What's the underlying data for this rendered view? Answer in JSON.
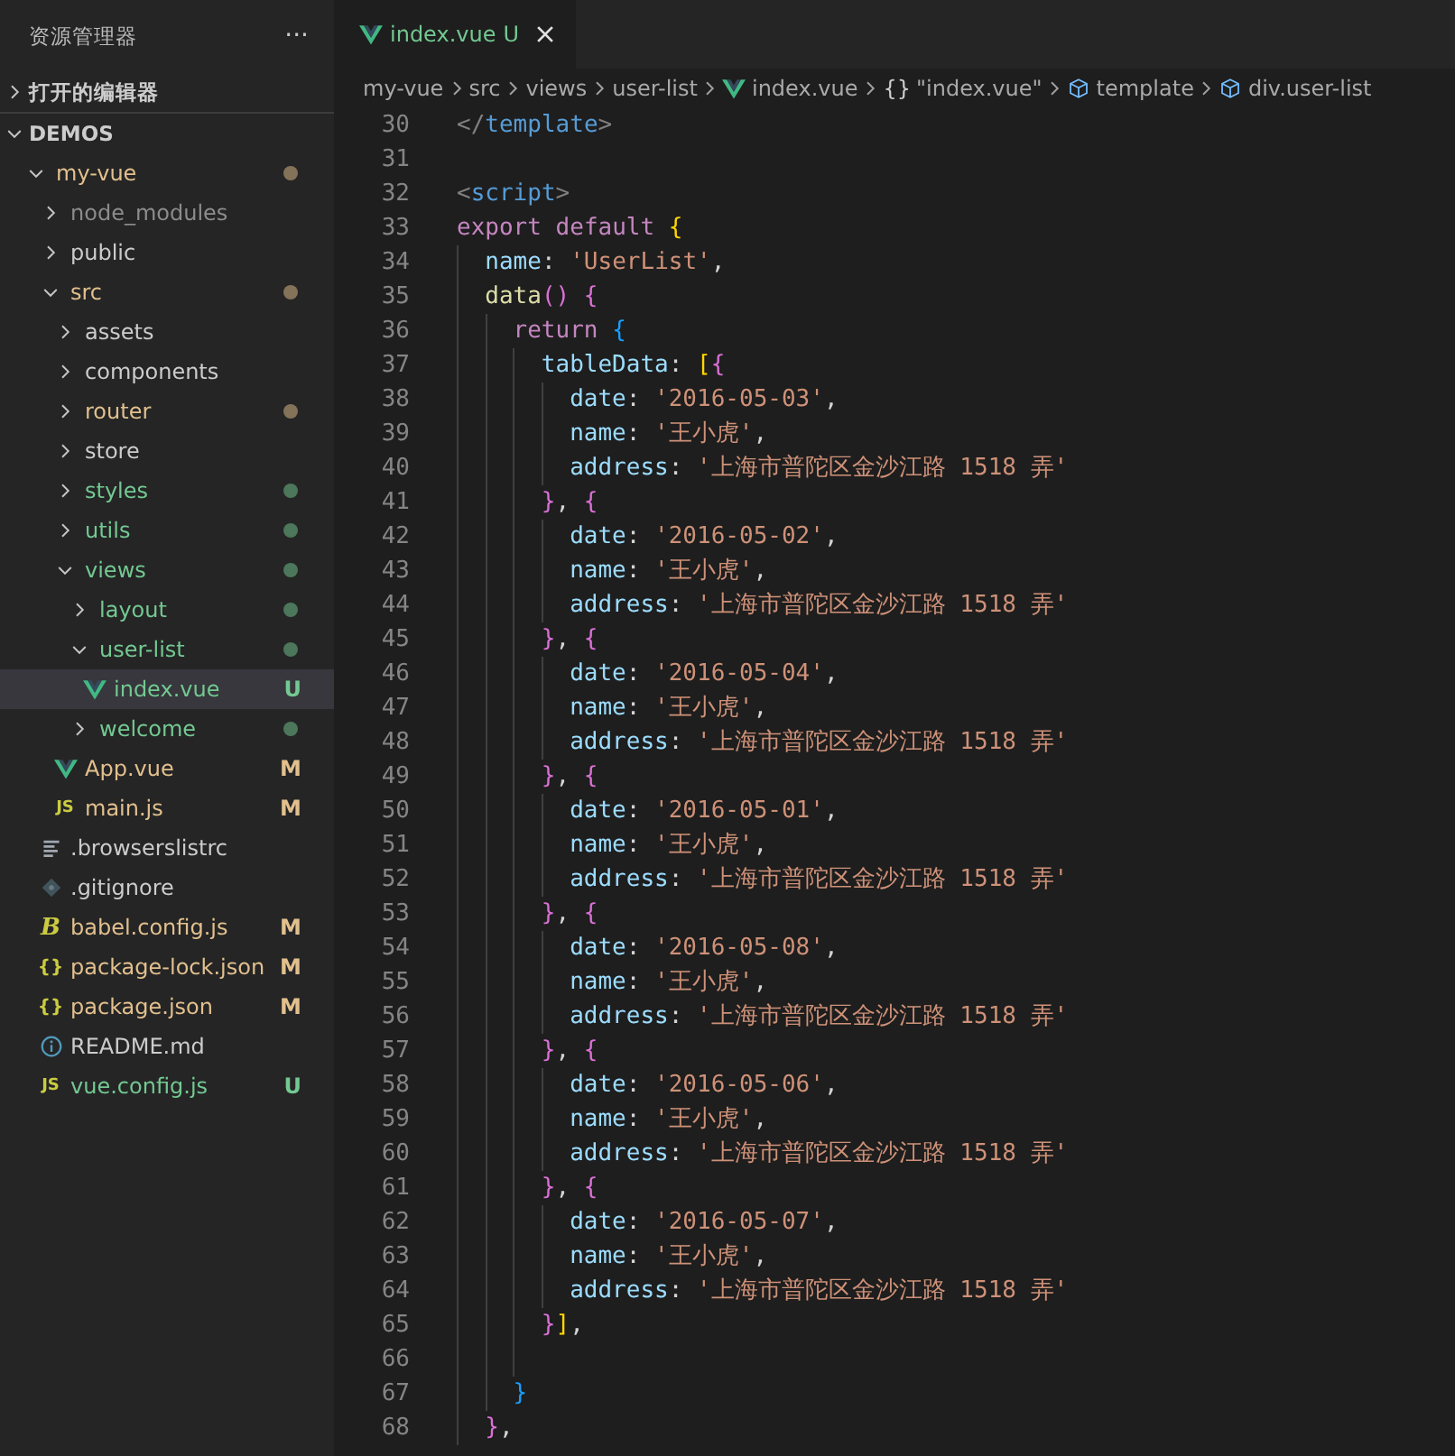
{
  "sidebar": {
    "title": "资源管理器",
    "more": "···",
    "sections": [
      {
        "label": "打开的编辑器",
        "expanded": false
      },
      {
        "label": "DEMOS",
        "expanded": true,
        "tree": [
          {
            "name": "my-vue",
            "kind": "folder",
            "expanded": true,
            "selected": false,
            "color": "#e2c08d",
            "dot": true,
            "children": [
              {
                "name": "node_modules",
                "kind": "folder",
                "expanded": false,
                "selected": false,
                "color": "#8c8c8c",
                "dot": false
              },
              {
                "name": "public",
                "kind": "folder",
                "expanded": false,
                "selected": false,
                "dot": false
              },
              {
                "name": "src",
                "kind": "folder",
                "expanded": true,
                "selected": false,
                "color": "#e2c08d",
                "dot": true,
                "children": [
                  {
                    "name": "assets",
                    "kind": "folder",
                    "expanded": false,
                    "selected": false,
                    "dot": false
                  },
                  {
                    "name": "components",
                    "kind": "folder",
                    "expanded": false,
                    "selected": false,
                    "dot": false
                  },
                  {
                    "name": "router",
                    "kind": "folder",
                    "expanded": false,
                    "selected": false,
                    "color": "#e2c08d",
                    "dot": true
                  },
                  {
                    "name": "store",
                    "kind": "folder",
                    "expanded": false,
                    "selected": false,
                    "dot": false
                  },
                  {
                    "name": "styles",
                    "kind": "folder",
                    "expanded": false,
                    "selected": false,
                    "color": "#73c991",
                    "dot": true
                  },
                  {
                    "name": "utils",
                    "kind": "folder",
                    "expanded": false,
                    "selected": false,
                    "color": "#73c991",
                    "dot": true
                  },
                  {
                    "name": "views",
                    "kind": "folder",
                    "expanded": true,
                    "selected": false,
                    "color": "#73c991",
                    "dot": true,
                    "children": [
                      {
                        "name": "layout",
                        "kind": "folder",
                        "expanded": false,
                        "selected": false,
                        "color": "#73c991",
                        "dot": true
                      },
                      {
                        "name": "user-list",
                        "kind": "folder",
                        "expanded": true,
                        "selected": false,
                        "color": "#73c991",
                        "dot": true,
                        "children": [
                          {
                            "name": "index.vue",
                            "kind": "vue",
                            "selected": true,
                            "color": "#73c991",
                            "badge": "U"
                          }
                        ]
                      },
                      {
                        "name": "welcome",
                        "kind": "folder",
                        "expanded": false,
                        "selected": false,
                        "color": "#73c991",
                        "dot": true
                      }
                    ]
                  },
                  {
                    "name": "App.vue",
                    "kind": "vue",
                    "selected": false,
                    "color": "#e2c08d",
                    "badge": "M"
                  },
                  {
                    "name": "main.js",
                    "kind": "js",
                    "icon_text": "JS",
                    "selected": false,
                    "color": "#e2c08d",
                    "badge": "M"
                  }
                ]
              },
              {
                "name": ".browserslistrc",
                "kind": "lines",
                "selected": false
              },
              {
                "name": ".gitignore",
                "kind": "diamond",
                "selected": false
              },
              {
                "name": "babel.config.js",
                "kind": "babel",
                "icon_text": "B",
                "selected": false,
                "color": "#e2c08d",
                "badge": "M"
              },
              {
                "name": "package-lock.json",
                "kind": "json",
                "icon_text": "{}",
                "selected": false,
                "color": "#e2c08d",
                "badge": "M"
              },
              {
                "name": "package.json",
                "kind": "json",
                "icon_text": "{}",
                "selected": false,
                "color": "#e2c08d",
                "badge": "M"
              },
              {
                "name": "README.md",
                "kind": "info",
                "selected": false
              },
              {
                "name": "vue.config.js",
                "kind": "js",
                "icon_text": "JS",
                "selected": false,
                "color": "#73c991",
                "badge": "U"
              }
            ]
          }
        ]
      }
    ]
  },
  "editor": {
    "tabs": [
      {
        "label": "index.vue",
        "badge": "U",
        "color": "#73c991",
        "selected": true
      }
    ],
    "breadcrumbs": [
      {
        "label": "my-vue",
        "kind": "folder"
      },
      {
        "label": "src",
        "kind": "folder"
      },
      {
        "label": "views",
        "kind": "folder"
      },
      {
        "label": "user-list",
        "kind": "folder"
      },
      {
        "label": "index.vue",
        "kind": "vue"
      },
      {
        "label": "\"index.vue\"",
        "kind": "object",
        "icon_text": "{}"
      },
      {
        "label": "template",
        "kind": "element"
      },
      {
        "label": "div.user-list",
        "kind": "element"
      }
    ],
    "lines": [
      {
        "number": "30",
        "tokens": [
          {
            "kind": "tagp",
            "text": "</"
          },
          {
            "kind": "tag",
            "text": "template"
          },
          {
            "kind": "tagp",
            "text": ">"
          }
        ]
      },
      {
        "number": "31"
      },
      {
        "number": "32",
        "tokens": [
          {
            "kind": "tagp",
            "text": "<"
          },
          {
            "kind": "tag",
            "text": "script"
          },
          {
            "kind": "tagp",
            "text": ">"
          }
        ]
      },
      {
        "number": "33",
        "tokens": [
          {
            "kind": "kw",
            "text": "export default "
          },
          {
            "kind": "b1",
            "text": "{"
          }
        ],
        "children": [
          {
            "number": "34",
            "tokens": [
              {
                "kind": "prop",
                "text": "name"
              },
              {
                "kind": "p",
                "text": ": "
              },
              {
                "kind": "str",
                "text": "'UserList'"
              },
              {
                "kind": "p",
                "text": ","
              }
            ]
          },
          {
            "number": "35",
            "tokens": [
              {
                "kind": "fn",
                "text": "data"
              },
              {
                "kind": "b2",
                "text": "() {"
              }
            ],
            "children": [
              {
                "number": "36",
                "tokens": [
                  {
                    "kind": "kw",
                    "text": "return "
                  },
                  {
                    "kind": "b3",
                    "text": "{"
                  }
                ],
                "children": [
                  {
                    "number": "37",
                    "tokens": [
                      {
                        "kind": "prop",
                        "text": "tableData"
                      },
                      {
                        "kind": "p",
                        "text": ": "
                      },
                      {
                        "kind": "b1",
                        "text": "["
                      },
                      {
                        "kind": "b2",
                        "text": "{"
                      }
                    ],
                    "children": [
                      {
                        "number": "38",
                        "tokens": [
                          {
                            "kind": "prop",
                            "text": "date"
                          },
                          {
                            "kind": "p",
                            "text": ": "
                          },
                          {
                            "kind": "str",
                            "text": "'2016-05-03'"
                          },
                          {
                            "kind": "p",
                            "text": ","
                          }
                        ]
                      },
                      {
                        "number": "39",
                        "tokens": [
                          {
                            "kind": "prop",
                            "text": "name"
                          },
                          {
                            "kind": "p",
                            "text": ": "
                          },
                          {
                            "kind": "str",
                            "text": "'王小虎'"
                          },
                          {
                            "kind": "p",
                            "text": ","
                          }
                        ]
                      },
                      {
                        "number": "40",
                        "tokens": [
                          {
                            "kind": "prop",
                            "text": "address"
                          },
                          {
                            "kind": "p",
                            "text": ": "
                          },
                          {
                            "kind": "str",
                            "text": "'上海市普陀区金沙江路 1518 弄'"
                          }
                        ]
                      }
                    ]
                  },
                  {
                    "number": "41",
                    "tokens": [
                      {
                        "kind": "b2",
                        "text": "}"
                      },
                      {
                        "kind": "p",
                        "text": ", "
                      },
                      {
                        "kind": "b2",
                        "text": "{"
                      }
                    ],
                    "children": [
                      {
                        "number": "42",
                        "tokens": [
                          {
                            "kind": "prop",
                            "text": "date"
                          },
                          {
                            "kind": "p",
                            "text": ": "
                          },
                          {
                            "kind": "str",
                            "text": "'2016-05-02'"
                          },
                          {
                            "kind": "p",
                            "text": ","
                          }
                        ]
                      },
                      {
                        "number": "43",
                        "tokens": [
                          {
                            "kind": "prop",
                            "text": "name"
                          },
                          {
                            "kind": "p",
                            "text": ": "
                          },
                          {
                            "kind": "str",
                            "text": "'王小虎'"
                          },
                          {
                            "kind": "p",
                            "text": ","
                          }
                        ]
                      },
                      {
                        "number": "44",
                        "tokens": [
                          {
                            "kind": "prop",
                            "text": "address"
                          },
                          {
                            "kind": "p",
                            "text": ": "
                          },
                          {
                            "kind": "str",
                            "text": "'上海市普陀区金沙江路 1518 弄'"
                          }
                        ]
                      }
                    ]
                  },
                  {
                    "number": "45",
                    "tokens": [
                      {
                        "kind": "b2",
                        "text": "}"
                      },
                      {
                        "kind": "p",
                        "text": ", "
                      },
                      {
                        "kind": "b2",
                        "text": "{"
                      }
                    ],
                    "children": [
                      {
                        "number": "46",
                        "tokens": [
                          {
                            "kind": "prop",
                            "text": "date"
                          },
                          {
                            "kind": "p",
                            "text": ": "
                          },
                          {
                            "kind": "str",
                            "text": "'2016-05-04'"
                          },
                          {
                            "kind": "p",
                            "text": ","
                          }
                        ]
                      },
                      {
                        "number": "47",
                        "tokens": [
                          {
                            "kind": "prop",
                            "text": "name"
                          },
                          {
                            "kind": "p",
                            "text": ": "
                          },
                          {
                            "kind": "str",
                            "text": "'王小虎'"
                          },
                          {
                            "kind": "p",
                            "text": ","
                          }
                        ]
                      },
                      {
                        "number": "48",
                        "tokens": [
                          {
                            "kind": "prop",
                            "text": "address"
                          },
                          {
                            "kind": "p",
                            "text": ": "
                          },
                          {
                            "kind": "str",
                            "text": "'上海市普陀区金沙江路 1518 弄'"
                          }
                        ]
                      }
                    ]
                  },
                  {
                    "number": "49",
                    "tokens": [
                      {
                        "kind": "b2",
                        "text": "}"
                      },
                      {
                        "kind": "p",
                        "text": ", "
                      },
                      {
                        "kind": "b2",
                        "text": "{"
                      }
                    ],
                    "children": [
                      {
                        "number": "50",
                        "tokens": [
                          {
                            "kind": "prop",
                            "text": "date"
                          },
                          {
                            "kind": "p",
                            "text": ": "
                          },
                          {
                            "kind": "str",
                            "text": "'2016-05-01'"
                          },
                          {
                            "kind": "p",
                            "text": ","
                          }
                        ]
                      },
                      {
                        "number": "51",
                        "tokens": [
                          {
                            "kind": "prop",
                            "text": "name"
                          },
                          {
                            "kind": "p",
                            "text": ": "
                          },
                          {
                            "kind": "str",
                            "text": "'王小虎'"
                          },
                          {
                            "kind": "p",
                            "text": ","
                          }
                        ]
                      },
                      {
                        "number": "52",
                        "tokens": [
                          {
                            "kind": "prop",
                            "text": "address"
                          },
                          {
                            "kind": "p",
                            "text": ": "
                          },
                          {
                            "kind": "str",
                            "text": "'上海市普陀区金沙江路 1518 弄'"
                          }
                        ]
                      }
                    ]
                  },
                  {
                    "number": "53",
                    "tokens": [
                      {
                        "kind": "b2",
                        "text": "}"
                      },
                      {
                        "kind": "p",
                        "text": ", "
                      },
                      {
                        "kind": "b2",
                        "text": "{"
                      }
                    ],
                    "children": [
                      {
                        "number": "54",
                        "tokens": [
                          {
                            "kind": "prop",
                            "text": "date"
                          },
                          {
                            "kind": "p",
                            "text": ": "
                          },
                          {
                            "kind": "str",
                            "text": "'2016-05-08'"
                          },
                          {
                            "kind": "p",
                            "text": ","
                          }
                        ]
                      },
                      {
                        "number": "55",
                        "tokens": [
                          {
                            "kind": "prop",
                            "text": "name"
                          },
                          {
                            "kind": "p",
                            "text": ": "
                          },
                          {
                            "kind": "str",
                            "text": "'王小虎'"
                          },
                          {
                            "kind": "p",
                            "text": ","
                          }
                        ]
                      },
                      {
                        "number": "56",
                        "tokens": [
                          {
                            "kind": "prop",
                            "text": "address"
                          },
                          {
                            "kind": "p",
                            "text": ": "
                          },
                          {
                            "kind": "str",
                            "text": "'上海市普陀区金沙江路 1518 弄'"
                          }
                        ]
                      }
                    ]
                  },
                  {
                    "number": "57",
                    "tokens": [
                      {
                        "kind": "b2",
                        "text": "}"
                      },
                      {
                        "kind": "p",
                        "text": ", "
                      },
                      {
                        "kind": "b2",
                        "text": "{"
                      }
                    ],
                    "children": [
                      {
                        "number": "58",
                        "tokens": [
                          {
                            "kind": "prop",
                            "text": "date"
                          },
                          {
                            "kind": "p",
                            "text": ": "
                          },
                          {
                            "kind": "str",
                            "text": "'2016-05-06'"
                          },
                          {
                            "kind": "p",
                            "text": ","
                          }
                        ]
                      },
                      {
                        "number": "59",
                        "tokens": [
                          {
                            "kind": "prop",
                            "text": "name"
                          },
                          {
                            "kind": "p",
                            "text": ": "
                          },
                          {
                            "kind": "str",
                            "text": "'王小虎'"
                          },
                          {
                            "kind": "p",
                            "text": ","
                          }
                        ]
                      },
                      {
                        "number": "60",
                        "tokens": [
                          {
                            "kind": "prop",
                            "text": "address"
                          },
                          {
                            "kind": "p",
                            "text": ": "
                          },
                          {
                            "kind": "str",
                            "text": "'上海市普陀区金沙江路 1518 弄'"
                          }
                        ]
                      }
                    ]
                  },
                  {
                    "number": "61",
                    "tokens": [
                      {
                        "kind": "b2",
                        "text": "}"
                      },
                      {
                        "kind": "p",
                        "text": ", "
                      },
                      {
                        "kind": "b2",
                        "text": "{"
                      }
                    ],
                    "children": [
                      {
                        "number": "62",
                        "tokens": [
                          {
                            "kind": "prop",
                            "text": "date"
                          },
                          {
                            "kind": "p",
                            "text": ": "
                          },
                          {
                            "kind": "str",
                            "text": "'2016-05-07'"
                          },
                          {
                            "kind": "p",
                            "text": ","
                          }
                        ]
                      },
                      {
                        "number": "63",
                        "tokens": [
                          {
                            "kind": "prop",
                            "text": "name"
                          },
                          {
                            "kind": "p",
                            "text": ": "
                          },
                          {
                            "kind": "str",
                            "text": "'王小虎'"
                          },
                          {
                            "kind": "p",
                            "text": ","
                          }
                        ]
                      },
                      {
                        "number": "64",
                        "tokens": [
                          {
                            "kind": "prop",
                            "text": "address"
                          },
                          {
                            "kind": "p",
                            "text": ": "
                          },
                          {
                            "kind": "str",
                            "text": "'上海市普陀区金沙江路 1518 弄'"
                          }
                        ]
                      }
                    ]
                  },
                  {
                    "number": "65",
                    "tokens": [
                      {
                        "kind": "b2",
                        "text": "}"
                      },
                      {
                        "kind": "b1",
                        "text": "]"
                      },
                      {
                        "kind": "p",
                        "text": ","
                      }
                    ]
                  },
                  {
                    "number": "66"
                  }
                ]
              },
              {
                "number": "67",
                "tokens": [
                  {
                    "kind": "b3",
                    "text": "}"
                  }
                ]
              }
            ]
          },
          {
            "number": "68",
            "tokens": [
              {
                "kind": "b2",
                "text": "}"
              },
              {
                "kind": "p",
                "text": ","
              }
            ]
          }
        ]
      }
    ]
  }
}
